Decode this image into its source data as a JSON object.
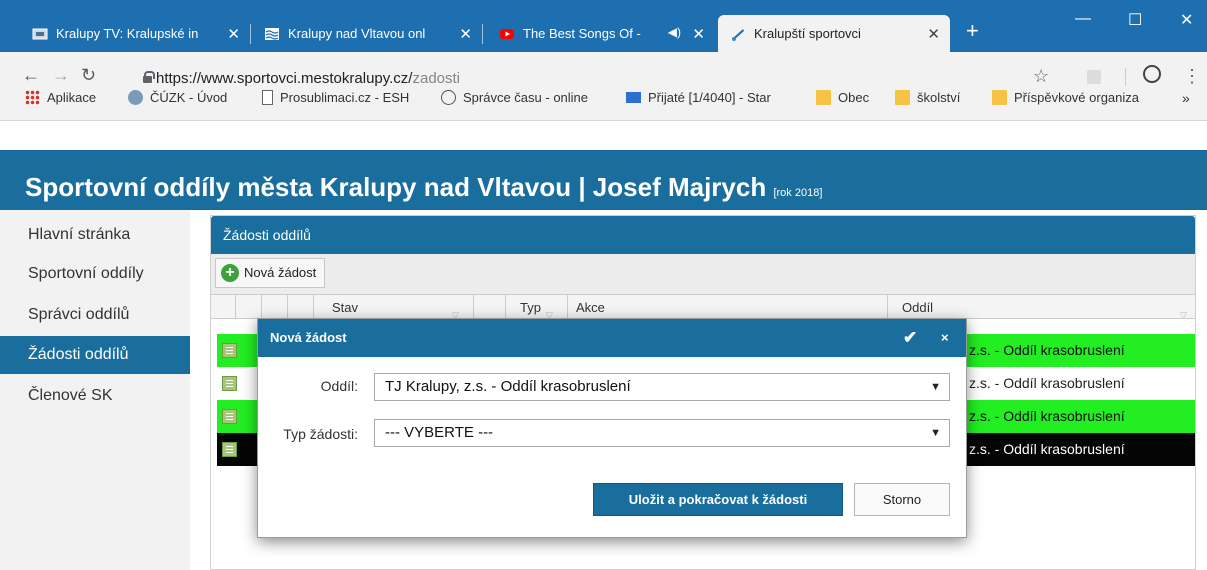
{
  "browser": {
    "tabs": [
      {
        "title": "Kralupy TV: Kralupské in",
        "active": false
      },
      {
        "title": "Kralupy nad Vltavou onl",
        "active": false
      },
      {
        "title": "The Best Songs Of -",
        "active": false
      },
      {
        "title": "Kralupští sportovci",
        "active": true
      }
    ],
    "url_host": "https://www.sportovci.mestokralupy.cz/",
    "url_path": "zadosti",
    "bookmarks": [
      {
        "label": "Aplikace",
        "icon": "apps-grid-icon"
      },
      {
        "label": "ČÚZK - Úvod",
        "icon": "cuzk-icon"
      },
      {
        "label": "Prosublimaci.cz - ESH",
        "icon": "page-icon"
      },
      {
        "label": "Správce času - online",
        "icon": "clock-icon"
      },
      {
        "label": "Přijaté [1/4040] - Star",
        "icon": "mail-icon"
      },
      {
        "label": "Obec",
        "icon": "folder-icon"
      },
      {
        "label": "školství",
        "icon": "folder-icon"
      },
      {
        "label": "Příspěvkové organiza",
        "icon": "folder-icon"
      }
    ],
    "more_bookmarks": "»",
    "new_tab_symbol": "+",
    "window_controls": {
      "minimize": "—",
      "maximize": "☐",
      "close": "✕"
    }
  },
  "app": {
    "title": "Sportovní oddíly města Kralupy nad Vltavou | Josef Majrych",
    "year": "[rok 2018]",
    "accent_color": "#1a6e9e"
  },
  "sidebar": {
    "items": [
      {
        "label": "Hlavní stránka",
        "active": false
      },
      {
        "label": "Sportovní oddíly",
        "active": false
      },
      {
        "label": "Správci oddílů",
        "active": false
      },
      {
        "label": "Žádosti oddílů",
        "active": true
      },
      {
        "label": "Členové SK",
        "active": false
      }
    ]
  },
  "panel": {
    "title": "Žádosti oddílů",
    "new_button": "Nová žádost",
    "columns": {
      "stav": "Stav",
      "typ": "Typ",
      "akce": "Akce",
      "oddil": "Oddíl"
    },
    "rows": [
      {
        "oddil": "z.s. - Oddíl krasobruslení",
        "bg": "#22ee22",
        "fg": "#111111"
      },
      {
        "oddil": "z.s. - Oddíl krasobruslení",
        "bg": "#ffffff",
        "fg": "#222222"
      },
      {
        "oddil": "z.s. - Oddíl krasobruslení",
        "bg": "#22ee22",
        "fg": "#111111"
      },
      {
        "oddil": "z.s. - Oddíl krasobruslení",
        "bg": "#050505",
        "fg": "#ffffff"
      }
    ]
  },
  "modal": {
    "title": "Nová žádost",
    "confirm_symbol": "✔",
    "close_symbol": "×",
    "oddil_label": "Oddíl:",
    "oddil_value": "TJ Kralupy, z.s. - Oddíl krasobruslení",
    "typ_label": "Typ žádosti:",
    "typ_value": "--- VYBERTE ---",
    "save_button": "Uložit a pokračovat k žádosti",
    "cancel_button": "Storno"
  }
}
